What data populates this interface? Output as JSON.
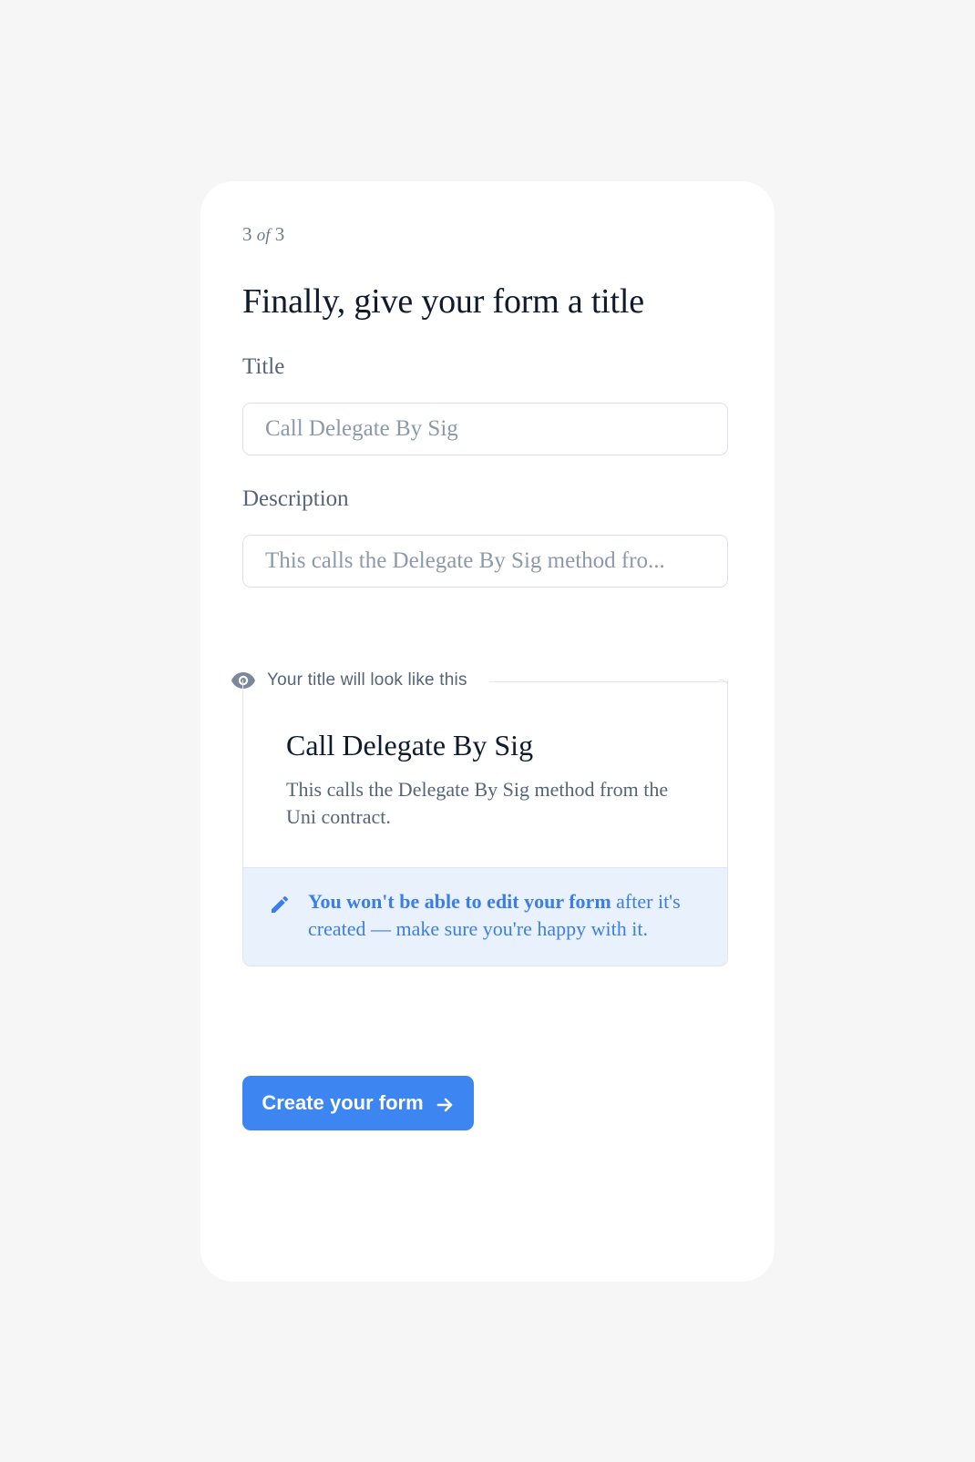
{
  "step": {
    "current": "3",
    "of": "of",
    "total": "3"
  },
  "heading": "Finally, give your form a title",
  "fields": {
    "title": {
      "label": "Title",
      "value": "Call Delegate By Sig"
    },
    "description": {
      "label": "Description",
      "value": "This calls the Delegate By Sig method fro..."
    }
  },
  "preview": {
    "header_icon": "eye-icon",
    "header_label": "Your title will look like this",
    "title": "Call Delegate By Sig",
    "description": "This calls the Delegate By Sig method from the Uni contract."
  },
  "notice": {
    "icon": "pencil-icon",
    "bold_text": "You won't be able to edit your form",
    "rest_text": " after it's created — make sure you're happy with it."
  },
  "cta": {
    "label": "Create your form",
    "icon": "arrow-right-icon"
  },
  "colors": {
    "accent": "#3d86f1",
    "notice_bg": "#e9f1fd",
    "heading": "#0f1b2d",
    "muted": "#56647a",
    "page_bg": "#f6f6f6"
  }
}
